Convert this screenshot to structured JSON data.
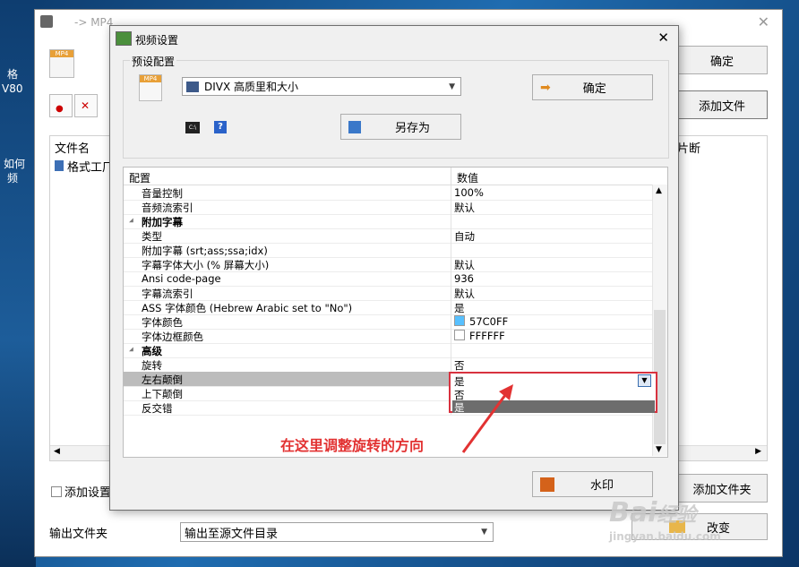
{
  "outer": {
    "title": "-> MP4",
    "confirm": "确定",
    "add_file": "添加文件",
    "file_col": "文件名",
    "file_item": "格式工厂",
    "col_right": "片断",
    "add_settings": "添加设置名",
    "add_folder": "添加文件夹",
    "output_folder_label": "输出文件夹",
    "output_folder_value": "输出至源文件目录",
    "change": "改变"
  },
  "desktop": {
    "l1": "格",
    "l2": "V80",
    "l3": "如何",
    "l4": "频"
  },
  "dialog": {
    "title": "视频设置",
    "preset_group": "预设配置",
    "preset_value": "DIVX 高质里和大小",
    "ok": "确定",
    "save_as": "另存为",
    "help": "?",
    "cmd": "C:\\",
    "watermark_btn": "水印"
  },
  "grid": {
    "col_config": "配置",
    "col_value": "数值",
    "rows": [
      {
        "k": "音量控制",
        "v": "100%"
      },
      {
        "k": "音频流索引",
        "v": "默认"
      },
      {
        "k": "附加字幕",
        "v": "",
        "cat": true
      },
      {
        "k": "类型",
        "v": "自动"
      },
      {
        "k": "附加字幕 (srt;ass;ssa;idx)",
        "v": ""
      },
      {
        "k": "字幕字体大小 (% 屏幕大小)",
        "v": "默认"
      },
      {
        "k": "Ansi code-page",
        "v": "936"
      },
      {
        "k": "字幕流索引",
        "v": "默认"
      },
      {
        "k": "ASS 字体颜色 (Hebrew Arabic set to \"No\")",
        "v": "是"
      },
      {
        "k": "字体颜色",
        "v": "57C0FF",
        "swatch": "#57C0FF"
      },
      {
        "k": "字体边框颜色",
        "v": "FFFFFF",
        "swatch": "#FFFFFF"
      },
      {
        "k": "高级",
        "v": "",
        "cat": true
      },
      {
        "k": "旋转",
        "v": "否"
      },
      {
        "k": "左右颠倒",
        "v": "是",
        "selected": true
      },
      {
        "k": "上下颠倒",
        "v": ""
      },
      {
        "k": "反交错",
        "v": ""
      }
    ]
  },
  "dropdown": {
    "current": "是",
    "options": [
      "否",
      "是"
    ]
  },
  "annotation": "在这里调整旋转的方向",
  "watermark": {
    "brand": "Bai",
    "brand2": "经验",
    "url": "jingyan.baidu.com"
  },
  "colors": {
    "accent_red": "#e23232",
    "font_color": "#57C0FF",
    "selected_option": "#6d6d6d"
  }
}
